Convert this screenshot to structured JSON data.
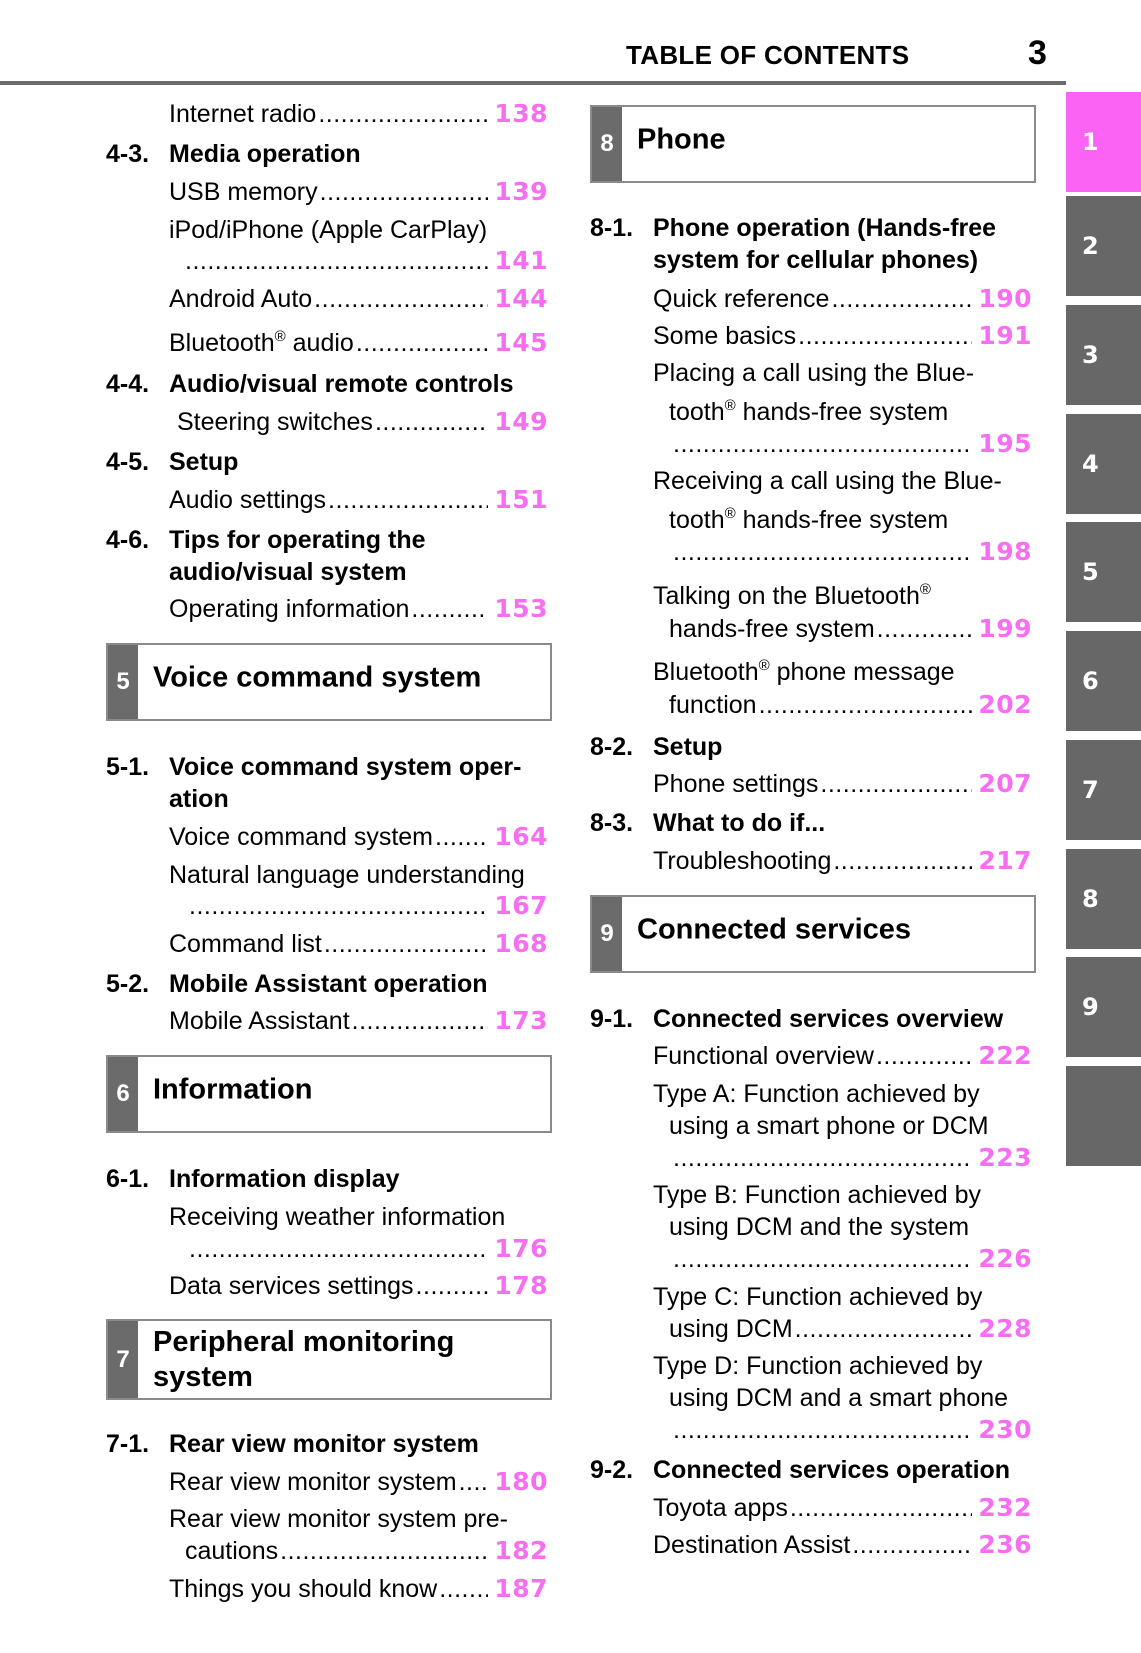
{
  "header": {
    "title": "TABLE OF CONTENTS",
    "page_number": "3"
  },
  "tabs": [
    {
      "label": "1",
      "active": true
    },
    {
      "label": "2"
    },
    {
      "label": "3"
    },
    {
      "label": "4"
    },
    {
      "label": "5"
    },
    {
      "label": "6"
    },
    {
      "label": "7"
    },
    {
      "label": "8"
    },
    {
      "label": "9"
    },
    {
      "label": ""
    }
  ],
  "colors": {
    "page_number": "#f76ef2",
    "tab_active": "#fb63f4",
    "tab": "#676767"
  },
  "left": {
    "internet_radio": {
      "text": "Internet radio",
      "page": "138"
    },
    "s4_3": {
      "num": "4-3.",
      "title": "Media operation"
    },
    "usb": {
      "text": "USB memory",
      "page": "139"
    },
    "ipod": {
      "text": "iPod/iPhone (Apple CarPlay)",
      "page": "141"
    },
    "android": {
      "text": "Android Auto",
      "page": "144"
    },
    "bt_audio": {
      "text": "Bluetooth",
      "sup": "®",
      "text2": " audio",
      "page": "145"
    },
    "s4_4": {
      "num": "4-4.",
      "title": "Audio/visual remote controls"
    },
    "steering": {
      "text": "Steering switches",
      "page": "149"
    },
    "s4_5": {
      "num": "4-5.",
      "title": "Setup"
    },
    "audio_settings": {
      "text": "Audio settings",
      "page": "151"
    },
    "s4_6": {
      "num": "4-6.",
      "title_l1": "Tips for operating the",
      "title_l2": "audio/visual system"
    },
    "operating_info": {
      "text": "Operating information",
      "page": "153"
    },
    "box5": {
      "num": "5",
      "title": "Voice command system"
    },
    "s5_1": {
      "num": "5-1.",
      "title_l1": "Voice command system oper-",
      "title_l2": "ation"
    },
    "voice_cmd": {
      "text": "Voice command system",
      "page": "164"
    },
    "nlu": {
      "text": "Natural language understanding",
      "page": "167"
    },
    "cmd_list": {
      "text": "Command list",
      "page": "168"
    },
    "s5_2": {
      "num": "5-2.",
      "title": "Mobile Assistant operation"
    },
    "mobile_assistant": {
      "text": "Mobile Assistant",
      "page": "173"
    },
    "box6": {
      "num": "6",
      "title": "Information"
    },
    "s6_1": {
      "num": "6-1.",
      "title": "Information display"
    },
    "weather": {
      "text": "Receiving weather information",
      "page": "176"
    },
    "data_services": {
      "text": "Data services settings",
      "page": "178"
    },
    "box7": {
      "num": "7",
      "title_l1": "Peripheral monitoring",
      "title_l2": "system"
    },
    "s7_1": {
      "num": "7-1.",
      "title": "Rear view monitor system"
    },
    "rvm": {
      "text": "Rear view monitor system",
      "page": "180"
    },
    "rvm_pre": {
      "text_l1": "Rear view monitor system pre-",
      "text_l2": "cautions",
      "page": "182"
    },
    "things": {
      "text": "Things you should know",
      "page": "187"
    }
  },
  "right": {
    "box8": {
      "num": "8",
      "title": "Phone"
    },
    "s8_1": {
      "num": "8-1.",
      "title_l1": "Phone operation (Hands-free",
      "title_l2": "system for cellular phones)"
    },
    "quick_ref": {
      "text": "Quick reference",
      "page": "190"
    },
    "basics": {
      "text": "Some basics",
      "page": "191"
    },
    "placing": {
      "text_l1": "Placing a call using the Blue-",
      "text_l2a": "tooth",
      "sup": "®",
      "text_l2b": " hands-free system",
      "page": "195"
    },
    "receiving": {
      "text_l1": "Receiving a call using the Blue-",
      "text_l2a": "tooth",
      "sup": "®",
      "text_l2b": " hands-free system",
      "page": "198"
    },
    "talking": {
      "text_l1": "Talking on the Bluetooth",
      "sup": "®",
      "text_l2": "hands-free system",
      "page": "199"
    },
    "bt_msg": {
      "text_l1a": "Bluetooth",
      "sup": "®",
      "text_l1b": " phone message",
      "text_l2": "function",
      "page": "202"
    },
    "s8_2": {
      "num": "8-2.",
      "title": "Setup"
    },
    "phone_settings": {
      "text": "Phone settings",
      "page": "207"
    },
    "s8_3": {
      "num": "8-3.",
      "title": "What to do if..."
    },
    "troubleshooting": {
      "text": "Troubleshooting",
      "page": "217"
    },
    "box9": {
      "num": "9",
      "title": "Connected services"
    },
    "s9_1": {
      "num": "9-1.",
      "title": "Connected services overview"
    },
    "func_overview": {
      "text": "Functional overview",
      "page": "222"
    },
    "type_a": {
      "text_l1": "Type A: Function achieved by",
      "text_l2": "using a smart phone or DCM",
      "page": "223"
    },
    "type_b": {
      "text_l1": "Type B: Function achieved by",
      "text_l2": "using DCM and the system",
      "page": "226"
    },
    "type_c": {
      "text_l1": "Type C: Function achieved by",
      "text_l2": "using DCM",
      "page": "228"
    },
    "type_d": {
      "text_l1": "Type D: Function achieved by",
      "text_l2": "using DCM and a smart phone",
      "page": "230"
    },
    "s9_2": {
      "num": "9-2.",
      "title": "Connected services operation"
    },
    "toyota_apps": {
      "text": "Toyota apps",
      "page": "232"
    },
    "dest_assist": {
      "text": "Destination Assist",
      "page": "236"
    }
  }
}
